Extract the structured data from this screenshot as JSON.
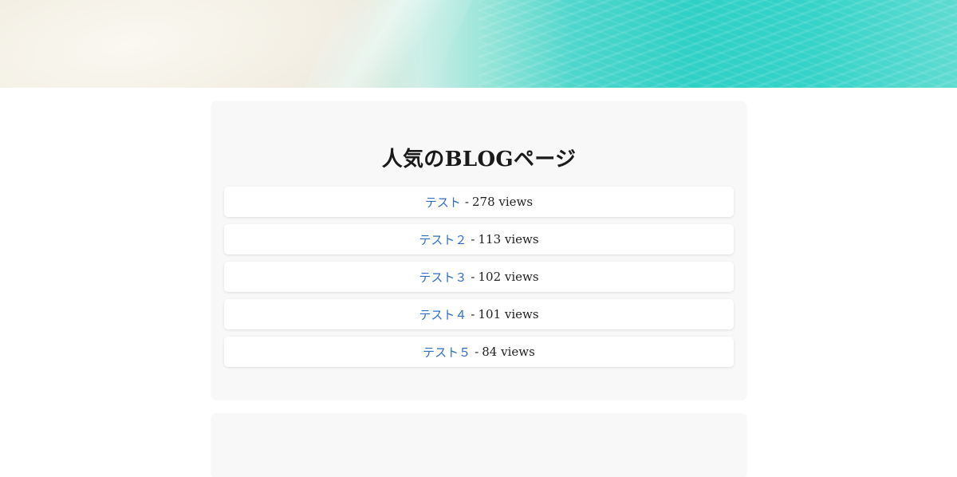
{
  "hero": {
    "image": "beach-shoreline-header"
  },
  "popular": {
    "title": "人気のBLOGページ",
    "separator": "-",
    "items": [
      {
        "link": "テスト",
        "views": "278 views"
      },
      {
        "link": "テスト２",
        "views": "113 views"
      },
      {
        "link": "テスト３",
        "views": "102 views"
      },
      {
        "link": "テスト４",
        "views": "101 views"
      },
      {
        "link": "テスト５",
        "views": "84 views"
      }
    ]
  },
  "colors": {
    "link": "#2f6fc2",
    "card_bg": "#f8f8f8",
    "item_bg": "#ffffff"
  }
}
